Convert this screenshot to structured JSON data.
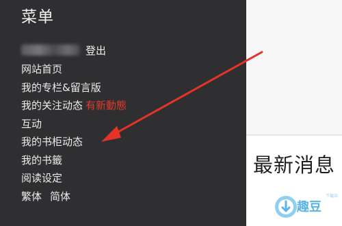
{
  "sidebar": {
    "title": "菜单",
    "logout_label": "登出",
    "items": [
      {
        "label": "网站首页"
      },
      {
        "label": "我的专栏&留言版"
      },
      {
        "label": "我的关注动态",
        "badge": "有新動態"
      },
      {
        "label": "互动"
      },
      {
        "label": "我的书柜动态"
      },
      {
        "label": "我的书籤"
      },
      {
        "label": "阅读设定"
      }
    ],
    "languages": [
      "繁体",
      "简体"
    ]
  },
  "content": {
    "heading": "最新消息"
  },
  "annotation": {
    "arrow_color": "#e53329"
  },
  "watermark": {
    "text": "趣豆",
    "subtext": "下载站",
    "icon": "download-circle-icon",
    "color": "#5ab4e6"
  }
}
